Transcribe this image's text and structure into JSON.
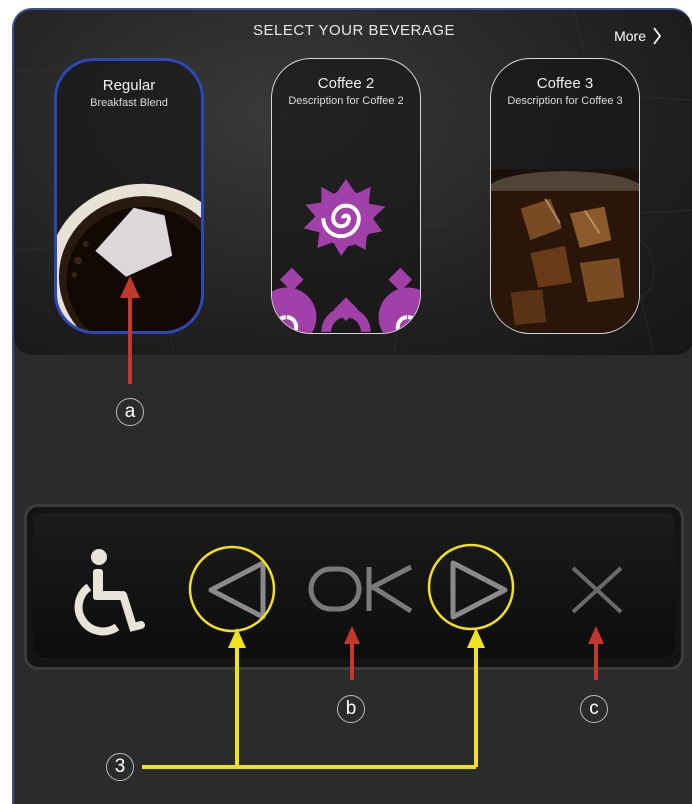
{
  "screen": {
    "title": "SELECT YOUR BEVERAGE",
    "more_label": "More"
  },
  "beverages": [
    {
      "name": "Regular",
      "description": "Breakfast Blend",
      "selected": true
    },
    {
      "name": "Coffee 2",
      "description": "Description for Coffee 2",
      "selected": false
    },
    {
      "name": "Coffee 3",
      "description": "Description for Coffee 3",
      "selected": false
    }
  ],
  "panel": {
    "buttons": [
      "accessibility-icon",
      "left-arrow-icon",
      "ok-button",
      "right-arrow-icon",
      "close-icon"
    ],
    "ok_label": "OK"
  },
  "annotations": {
    "a": "a",
    "b": "b",
    "c": "c",
    "three": "3"
  },
  "colors": {
    "selected_border": "#2d46b8",
    "annotation_red": "#c0392b",
    "annotation_yellow": "#f2e21b",
    "flower_purple": "#a040a8"
  }
}
